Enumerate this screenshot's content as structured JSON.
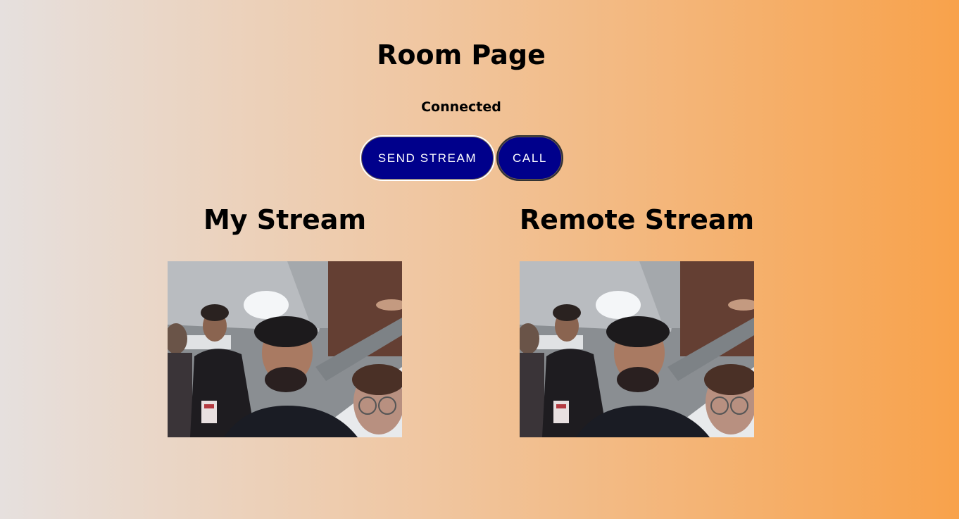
{
  "page": {
    "title": "Room Page",
    "status": "Connected"
  },
  "controls": {
    "send_stream_label": "SEND STREAM",
    "call_label": "CALL"
  },
  "streams": {
    "mine": {
      "heading": "My Stream"
    },
    "remote": {
      "heading": "Remote Stream"
    }
  },
  "colors": {
    "button_bg": "#00008b",
    "gradient_start": "#e6e0de",
    "gradient_end": "#f8a24b"
  }
}
